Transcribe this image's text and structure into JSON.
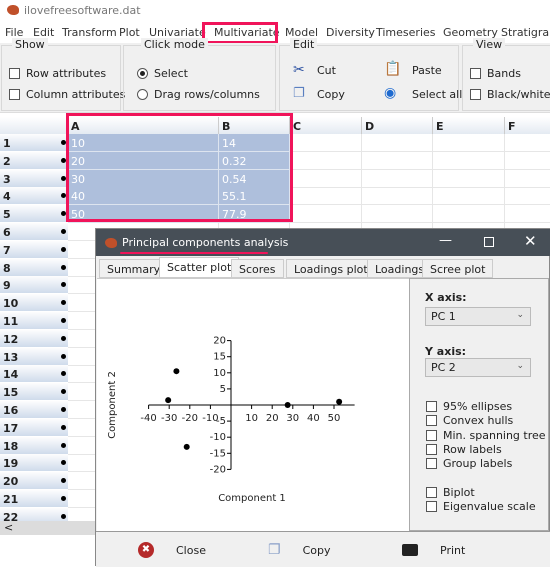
{
  "window": {
    "title": "ilovefreesoftware.dat"
  },
  "menu": [
    "File",
    "Edit",
    "Transform",
    "Plot",
    "Univariate",
    "Multivariate",
    "Model",
    "Diversity",
    "Timeseries",
    "Geometry",
    "Stratigraphy"
  ],
  "toolbar": {
    "show": {
      "label": "Show",
      "row_attributes": "Row attributes",
      "column_attributes": "Column attributes"
    },
    "click_mode": {
      "label": "Click mode",
      "select": "Select",
      "drag": "Drag rows/columns",
      "selected": "Select"
    },
    "edit": {
      "label": "Edit",
      "cut": "Cut",
      "paste": "Paste",
      "copy": "Copy",
      "select_all": "Select all"
    },
    "view": {
      "label": "View",
      "bands": "Bands",
      "bw": "Black/white"
    }
  },
  "grid": {
    "columns": [
      "A",
      "B",
      "C",
      "D",
      "E",
      "F"
    ],
    "rows": [
      "1",
      "2",
      "3",
      "4",
      "5",
      "6",
      "7",
      "8",
      "9",
      "10",
      "11",
      "12",
      "13",
      "14",
      "15",
      "16",
      "17",
      "18",
      "19",
      "20",
      "21",
      "22"
    ],
    "data": [
      [
        "10",
        "14"
      ],
      [
        "20",
        "0.32"
      ],
      [
        "30",
        "0.54"
      ],
      [
        "40",
        "55.1"
      ],
      [
        "50",
        "77.9"
      ]
    ],
    "scroll_left": "<"
  },
  "dialog": {
    "title": "Principal components analysis",
    "tabs": [
      "Summary",
      "Scatter plot",
      "Scores",
      "Loadings plot",
      "Loadings",
      "Scree plot"
    ],
    "active_tab": "Scatter plot",
    "x_axis_label": "X axis:",
    "x_axis_value": "PC 1",
    "y_axis_label": "Y axis:",
    "y_axis_value": "PC 2",
    "options": [
      "95% ellipses",
      "Convex hulls",
      "Min. spanning tree",
      "Row labels",
      "Group labels"
    ],
    "options2": [
      "Biplot",
      "Eigenvalue scale"
    ],
    "buttons": {
      "close": "Close",
      "copy": "Copy",
      "print": "Print"
    }
  },
  "chart_data": {
    "type": "scatter",
    "xlabel": "Component 1",
    "ylabel": "Component 2",
    "xlim": [
      -40,
      60
    ],
    "ylim": [
      -20,
      20
    ],
    "xticks": [
      -40,
      -30,
      -20,
      -10,
      10,
      20,
      30,
      40,
      50
    ],
    "yticks": [
      20,
      15,
      10,
      5,
      -5,
      -10,
      -15,
      -20
    ],
    "points": [
      [
        -30.5,
        1.5
      ],
      [
        -26.5,
        10.5
      ],
      [
        -21.5,
        -13
      ],
      [
        27.5,
        0
      ],
      [
        52.5,
        1
      ]
    ],
    "color": "#000000"
  },
  "colors": {
    "highlight": "#f0145a",
    "selection": "#aebfdc",
    "dialog_title": "#474f57"
  }
}
